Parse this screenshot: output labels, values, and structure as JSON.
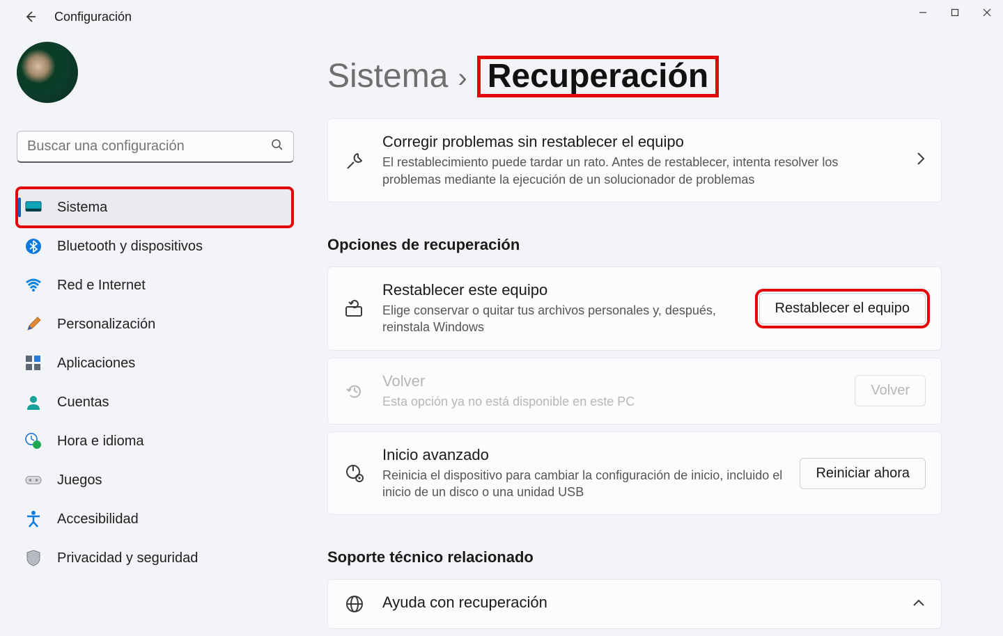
{
  "window": {
    "minimize_label": "Minimize",
    "maximize_label": "Maximize",
    "close_label": "Close"
  },
  "header": {
    "title": "Configuración"
  },
  "sidebar": {
    "search_placeholder": "Buscar una configuración",
    "items": [
      {
        "label": "Sistema",
        "icon": "monitor"
      },
      {
        "label": "Bluetooth y dispositivos",
        "icon": "bluetooth"
      },
      {
        "label": "Red e Internet",
        "icon": "wifi"
      },
      {
        "label": "Personalización",
        "icon": "brush"
      },
      {
        "label": "Aplicaciones",
        "icon": "apps"
      },
      {
        "label": "Cuentas",
        "icon": "person"
      },
      {
        "label": "Hora e idioma",
        "icon": "clock"
      },
      {
        "label": "Juegos",
        "icon": "gamepad"
      },
      {
        "label": "Accesibilidad",
        "icon": "accessibility"
      },
      {
        "label": "Privacidad y seguridad",
        "icon": "shield"
      }
    ]
  },
  "breadcrumb": {
    "parent": "Sistema",
    "current": "Recuperación"
  },
  "main": {
    "troubleshoot": {
      "title": "Corregir problemas sin restablecer el equipo",
      "desc": "El restablecimiento puede tardar un rato. Antes de restablecer, intenta resolver los problemas mediante la ejecución de un solucionador de problemas"
    },
    "section_recovery": "Opciones de recuperación",
    "reset": {
      "title": "Restablecer este equipo",
      "desc": "Elige conservar o quitar tus archivos personales y, después, reinstala Windows",
      "button": "Restablecer el equipo"
    },
    "goback": {
      "title": "Volver",
      "desc": "Esta opción ya no está disponible en este PC",
      "button": "Volver"
    },
    "advanced": {
      "title": "Inicio avanzado",
      "desc": "Reinicia el dispositivo para cambiar la configuración de inicio, incluido el inicio de un disco o una unidad USB",
      "button": "Reiniciar ahora"
    },
    "section_support": "Soporte técnico relacionado",
    "help": {
      "title": "Ayuda con recuperación"
    }
  },
  "colors": {
    "highlight": "#e30808",
    "accent": "#0067c0"
  }
}
